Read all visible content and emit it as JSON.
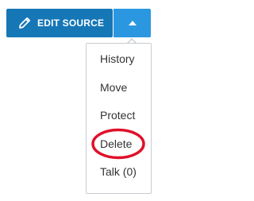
{
  "edit_button": {
    "label": "EDIT SOURCE",
    "icon": "pencil-icon"
  },
  "toggle_button": {
    "icon": "caret-up-icon"
  },
  "menu": {
    "items": [
      {
        "label": "History"
      },
      {
        "label": "Move"
      },
      {
        "label": "Protect"
      },
      {
        "label": "Delete",
        "highlighted": true
      },
      {
        "label": "Talk (0)"
      }
    ]
  },
  "colors": {
    "primary": "#1677b7",
    "primary_light": "#2b97e0",
    "menu_border": "#c8ccd1",
    "text": "#333333",
    "highlight": "#e0102a"
  }
}
